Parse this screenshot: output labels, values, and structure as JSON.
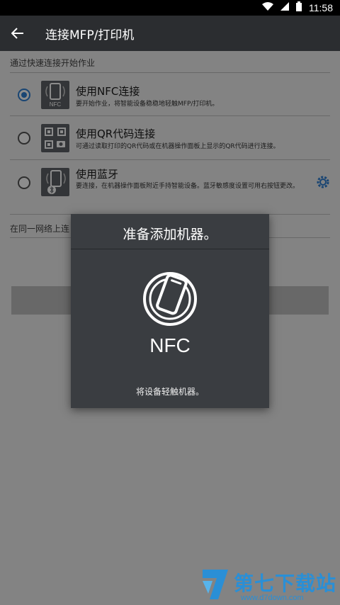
{
  "status_bar": {
    "time": "11:58"
  },
  "app_bar": {
    "title": "连接MFP/打印机"
  },
  "section_header": "通过快速连接开始作业",
  "options": [
    {
      "title": "使用NFC连接",
      "desc": "要开始作业，将智能设备稳稳地轻触MFP/打印机。",
      "icon_label": "NFC",
      "selected": true
    },
    {
      "title": "使用QR代码连接",
      "desc": "可通过读取打印的QR代码或在机器操作面板上显示的QR代码进行连接。",
      "selected": false
    },
    {
      "title": "使用蓝牙",
      "desc": "要连接，在机器操作面板附近手持智能设备。蓝牙敏感度设置可用右按钮更改。",
      "selected": false
    }
  ],
  "network_header": "在同一网络上连",
  "dialog": {
    "title": "准备添加机器。",
    "nfc_label": "NFC",
    "hint": "将设备轻触机器。"
  },
  "watermark": {
    "text": "第七下载站",
    "url": "www.d7down.com"
  },
  "colors": {
    "accent": "#2f7fd1",
    "app_bar": "#2b2d30",
    "dialog_bg": "#3a3d41"
  }
}
